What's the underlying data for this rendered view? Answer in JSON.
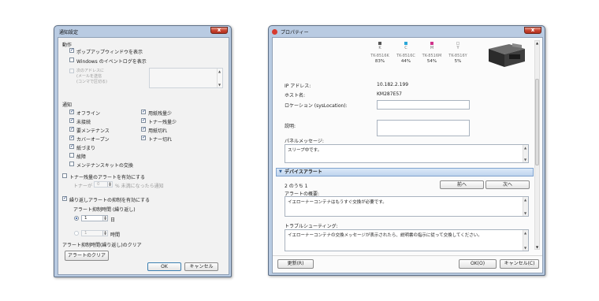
{
  "left_dialog": {
    "title": "通知設定",
    "close": "x",
    "behavior": {
      "heading": "動作",
      "popup_label": "ポップアップウィンドウを表示",
      "popup_checked": true,
      "eventlog_label": "Windows のイベントログを表示",
      "eventlog_checked": false,
      "email_label_1": "次のアドレスに",
      "email_label_2": "(メールを送信",
      "email_label_3": "(コンマで区切る)",
      "email_checked": false
    },
    "notify": {
      "heading": "通知",
      "items": [
        {
          "label": "オフライン",
          "checked": true
        },
        {
          "label": "未接続",
          "checked": true
        },
        {
          "label": "要メンテナンス",
          "checked": true
        },
        {
          "label": "カバーオープン",
          "checked": true
        },
        {
          "label": "紙づまり",
          "checked": true
        },
        {
          "label": "故障",
          "checked": false
        },
        {
          "label": "メンテナンスキットの交換",
          "checked": false
        },
        {
          "label": "用紙残量少",
          "checked": true
        },
        {
          "label": "トナー残量少",
          "checked": true
        },
        {
          "label": "用紙切れ",
          "checked": true
        },
        {
          "label": "トナー切れ",
          "checked": true
        }
      ]
    },
    "toner_alert": {
      "enable_label": "トナー残量のアラートを有効にする",
      "checked": false,
      "prefix": "トナーが",
      "value": "0",
      "suffix": "% 未満になったら通知"
    },
    "repeat": {
      "enable_label": "繰り返しアラートの抑制を有効にする",
      "checked": true,
      "interval_label": "アラート抑制時間 (繰り返し)",
      "days_value": "1",
      "days_unit": "日",
      "hours_value": "1",
      "hours_unit": "時間",
      "clear_label": "アラート抑制時間(繰り返し)のクリア",
      "clear_button": "アラートのクリア"
    },
    "ok": "OK",
    "cancel": "キャンセル"
  },
  "right_dialog": {
    "title": "プロパティー",
    "toners": [
      {
        "letter": "K",
        "model": "TK-8516K",
        "pct": "83%",
        "color": "#333333"
      },
      {
        "letter": "C",
        "model": "TK-8516C",
        "pct": "44%",
        "color": "#2aa7d8"
      },
      {
        "letter": "M",
        "model": "TK-8516M",
        "pct": "54%",
        "color": "#d0338b"
      },
      {
        "letter": "Y",
        "model": "TK-8516Y",
        "pct": "5%",
        "color": "#ece64a"
      }
    ],
    "ip_label": "IP アドレス:",
    "ip_value": "10.182.2.199",
    "host_label": "ホスト名:",
    "host_value": "KM287E57",
    "location_label": "ロケーション (sysLocation):",
    "location_value": "",
    "desc_label": "説明:",
    "desc_value": "",
    "panel_label": "パネルメッセージ:",
    "panel_value": "スリープ中です。",
    "device_alert": {
      "heading": "デバイスアラート",
      "count": "2 のうち 1",
      "prev": "前へ",
      "next": "次へ",
      "summary_label": "アラートの概要:",
      "summary_value": "イエローナーコンテナはもうすぐ交換が必要です。",
      "trouble_label": "トラブルシューティング:",
      "trouble_value": "イエローナーコンテナの交換メッセージが表示されたら、説明書の指示に従って交換してください。"
    },
    "refresh": "更新(R)",
    "ok": "OK(O)",
    "cancel": "キャンセル(C)"
  }
}
